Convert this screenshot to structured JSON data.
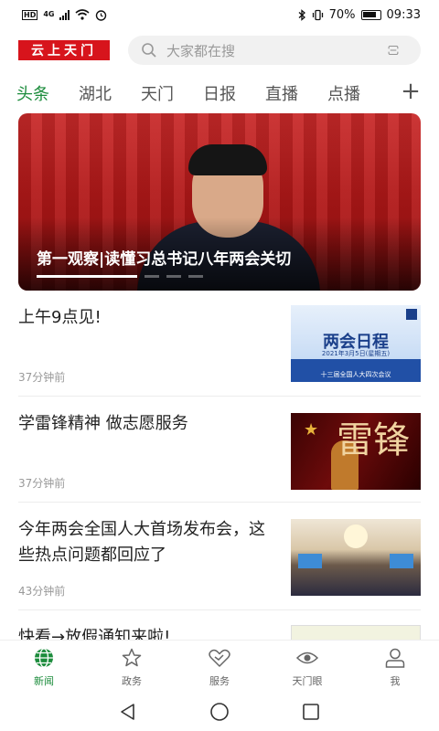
{
  "status_bar": {
    "network": "4G",
    "battery": "70%",
    "time": "09:33"
  },
  "header": {
    "logo_text": "云上天门",
    "search_placeholder": "大家都在搜"
  },
  "tabs": [
    {
      "label": "头条",
      "active": true
    },
    {
      "label": "湖北",
      "active": false
    },
    {
      "label": "天门",
      "active": false
    },
    {
      "label": "日报",
      "active": false
    },
    {
      "label": "直播",
      "active": false
    },
    {
      "label": "点播",
      "active": false
    }
  ],
  "add_tab_symbol": "+",
  "hero": {
    "title": "第一观察|读懂习总书记八年两会关切"
  },
  "news": [
    {
      "title": "上午9点见!",
      "time": "37分钟前",
      "thumb": {
        "caption": "两会日程",
        "date": "2021年3月5日(星期五)",
        "band": "十三届全国人大四次会议"
      }
    },
    {
      "title": "学雷锋精神 做志愿服务",
      "time": "37分钟前",
      "thumb": {
        "glyph": "雷锋"
      }
    },
    {
      "title": "今年两会全国人大首场发布会，这些热点问题都回应了",
      "time": "43分钟前"
    },
    {
      "title": "快看→放假通知来啦!",
      "time": ""
    }
  ],
  "bottom_nav": [
    {
      "label": "新闻",
      "icon": "globe-icon",
      "active": true
    },
    {
      "label": "政务",
      "icon": "star-icon",
      "active": false
    },
    {
      "label": "服务",
      "icon": "handshake-heart-icon",
      "active": false
    },
    {
      "label": "天门眼",
      "icon": "eye-icon",
      "active": false
    },
    {
      "label": "我",
      "icon": "person-icon",
      "active": false
    }
  ],
  "colors": {
    "brand_red": "#d7141c",
    "accent_green": "#1c8c3c"
  }
}
